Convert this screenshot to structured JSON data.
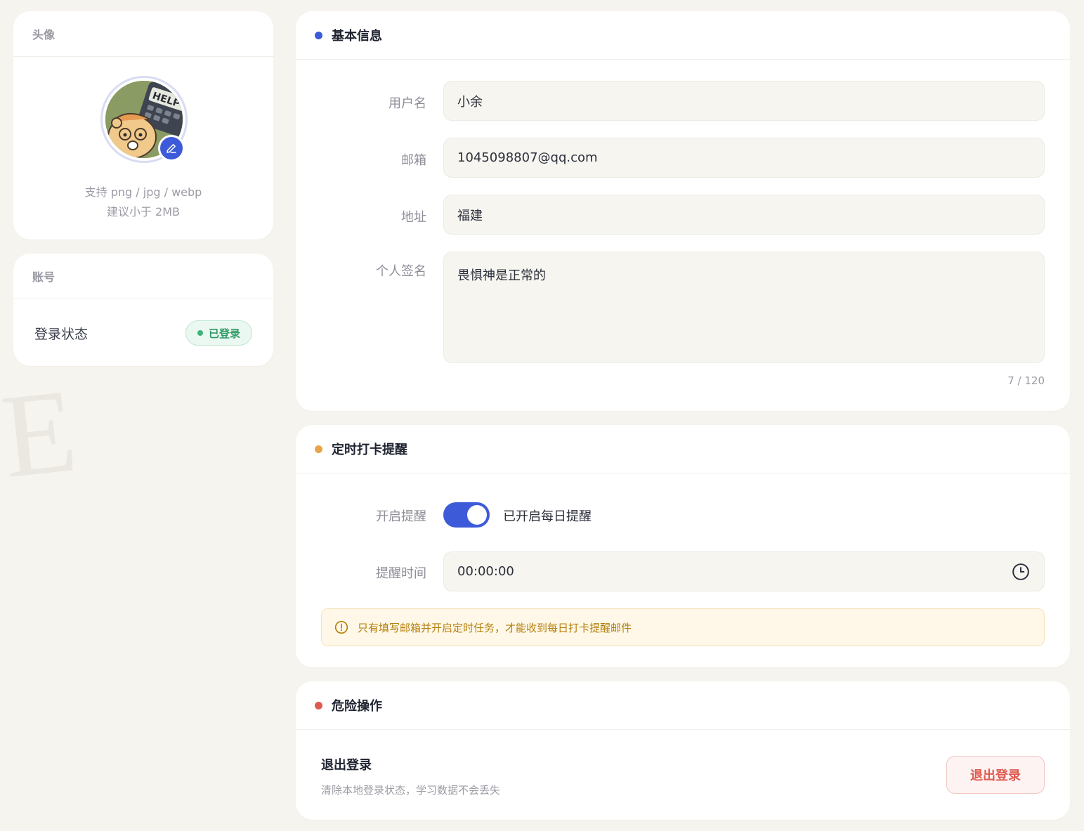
{
  "avatar_card": {
    "title": "头像",
    "hint_line1": "支持 png / jpg / webp",
    "hint_line2": "建议小于 2MB",
    "avatar_sign_text": "HELP"
  },
  "account_card": {
    "title": "账号",
    "login_label": "登录状态",
    "login_badge": "已登录"
  },
  "basic_info": {
    "title": "基本信息",
    "username_label": "用户名",
    "username_value": "小余",
    "email_label": "邮箱",
    "email_value": "1045098807@qq.com",
    "address_label": "地址",
    "address_value": "福建",
    "signature_label": "个人签名",
    "signature_value": "畏惧神是正常的",
    "signature_count": "7 / 120"
  },
  "reminder": {
    "title": "定时打卡提醒",
    "enable_label": "开启提醒",
    "enabled": true,
    "enable_status": "已开启每日提醒",
    "time_label": "提醒时间",
    "time_value": "00:00:00",
    "notice": "只有填写邮箱并开启定时任务，才能收到每日打卡提醒邮件"
  },
  "danger": {
    "title": "危险操作",
    "logout_title": "退出登录",
    "logout_desc": "清除本地登录状态，学习数据不会丢失",
    "logout_button": "退出登录"
  },
  "colors": {
    "accent": "#3d5bd9",
    "basic_dot": "#3d5bd9",
    "remind_dot": "#e9a44a",
    "danger_dot": "#e05a52",
    "success": "#2f9a66",
    "warning": "#b6800d"
  }
}
